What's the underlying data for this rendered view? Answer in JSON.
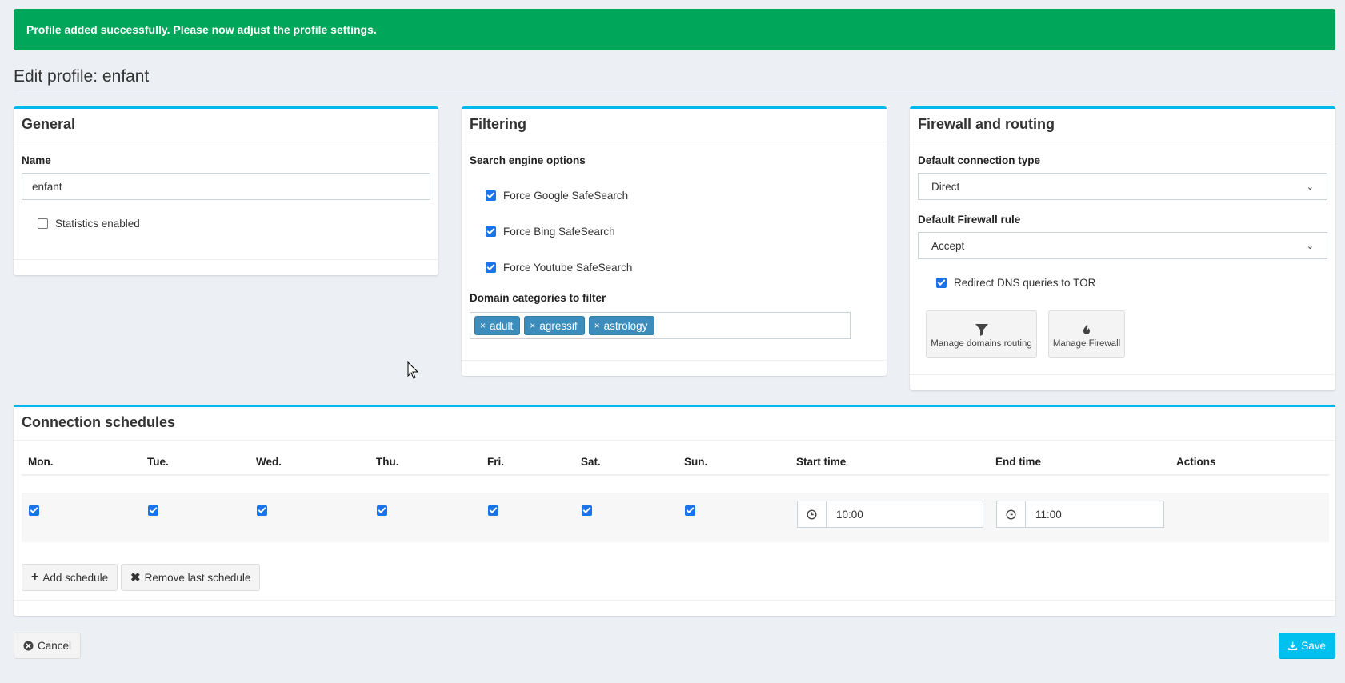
{
  "alert": {
    "text": "Profile added successfully. Please now adjust the profile settings."
  },
  "page": {
    "title": "Edit profile: enfant"
  },
  "general": {
    "title": "General",
    "name_label": "Name",
    "name_value": "enfant",
    "stats_label": "Statistics enabled",
    "stats_checked": false
  },
  "filtering": {
    "title": "Filtering",
    "search_label": "Search engine options",
    "options": [
      {
        "label": "Force Google SafeSearch",
        "checked": true
      },
      {
        "label": "Force Bing SafeSearch",
        "checked": true
      },
      {
        "label": "Force Youtube SafeSearch",
        "checked": true
      }
    ],
    "domains_label": "Domain categories to filter",
    "tags": [
      "adult",
      "agressif",
      "astrology"
    ]
  },
  "firewall": {
    "title": "Firewall and routing",
    "conn_label": "Default connection type",
    "conn_value": "Direct",
    "rule_label": "Default Firewall rule",
    "rule_value": "Accept",
    "tor_label": "Redirect DNS queries to TOR",
    "tor_checked": true,
    "manage_domains": "Manage domains routing",
    "manage_firewall": "Manage Firewall"
  },
  "schedules": {
    "title": "Connection schedules",
    "headers": [
      "Mon.",
      "Tue.",
      "Wed.",
      "Thu.",
      "Fri.",
      "Sat.",
      "Sun.",
      "Start time",
      "End time",
      "Actions"
    ],
    "row": {
      "days": [
        true,
        true,
        true,
        true,
        true,
        true,
        true
      ],
      "start": "10:00",
      "end": "11:00"
    },
    "add_label": "Add schedule",
    "remove_label": "Remove last schedule"
  },
  "footer": {
    "cancel_label": "Cancel",
    "save_label": "Save"
  },
  "colors": {
    "success": "#00a65a",
    "accent": "#00c0ef",
    "tag": "#3c8dbc",
    "checkbox": "#1a73e8"
  }
}
